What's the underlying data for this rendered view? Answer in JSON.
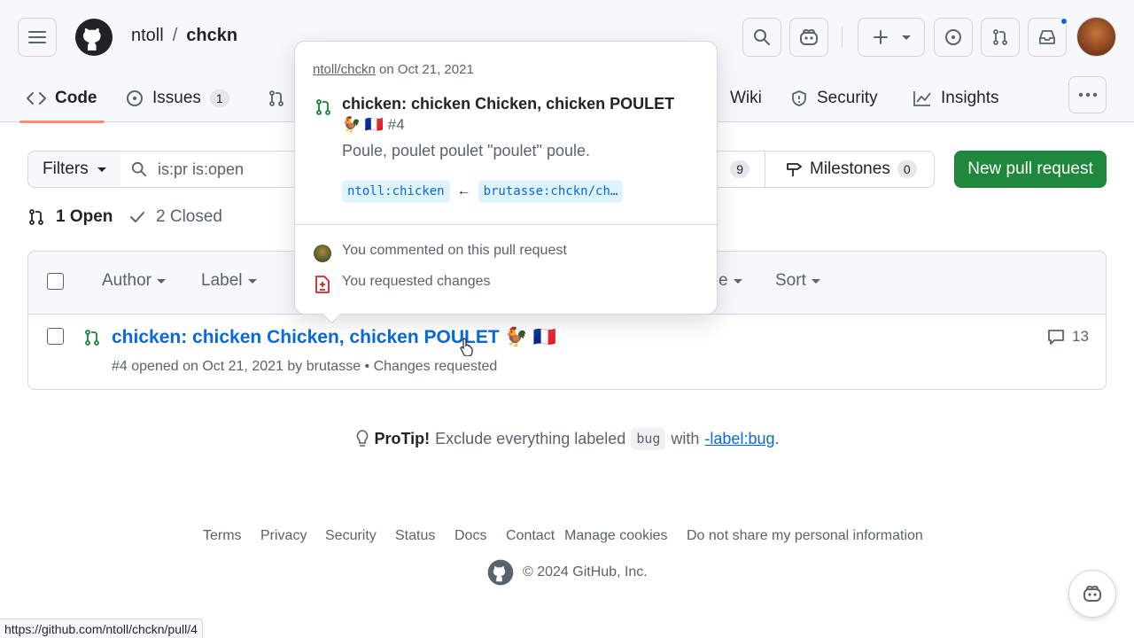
{
  "header": {
    "owner": "ntoll",
    "separator": "/",
    "repo": "chckn"
  },
  "tabs": [
    {
      "label": "Code",
      "icon": "code-icon"
    },
    {
      "label": "Issues",
      "count": "1",
      "icon": "issue-opened-icon"
    },
    {
      "label": "Wiki",
      "icon": "book-icon"
    },
    {
      "label": "Security",
      "icon": "shield-icon"
    },
    {
      "label": "Insights",
      "icon": "graph-icon"
    }
  ],
  "toolbar": {
    "filters_label": "Filters",
    "search_placeholder": "is:pr is:open",
    "labels_count": "9",
    "milestones_label": "Milestones",
    "milestones_count": "0",
    "new_pr_label": "New pull request"
  },
  "state_tabs": {
    "open": "1 Open",
    "closed": "2 Closed"
  },
  "list_filters": {
    "author": "Author",
    "label": "Label",
    "partial": "e",
    "sort": "Sort"
  },
  "pull_request": {
    "title": "chicken: chicken Chicken, chicken POULET 🐓 🇫🇷",
    "meta": "#4 opened on Oct 21, 2021 by brutasse • Changes requested",
    "comments": "13"
  },
  "popover": {
    "repo_link": "ntoll/chckn",
    "date": "on Oct 21, 2021",
    "title": "chicken: chicken Chicken, chicken POULET",
    "title_suffix": "🐓 🇫🇷 #4",
    "body": "Poule, poulet poulet \"poulet\" poule.",
    "base_branch": "ntoll:chicken",
    "arrow": "←",
    "head_branch": "brutasse:chckn/ch…",
    "activity_comment": "You commented on this pull request",
    "activity_review": "You requested changes"
  },
  "protip": {
    "lead": "ProTip!",
    "text_before": "Exclude everything labeled",
    "code": "bug",
    "text_mid": "with",
    "link": "-label:bug",
    "text_end": "."
  },
  "footer": {
    "links": [
      "Terms",
      "Privacy",
      "Security",
      "Status",
      "Docs",
      "Contact",
      "Manage cookies",
      "Do not share my personal information"
    ],
    "copyright": "© 2024 GitHub, Inc."
  },
  "status_url": "https://github.com/ntoll/chckn/pull/4",
  "colors": {
    "accent": "#0969da",
    "green": "#1f883d",
    "tab_underline": "#fd8c73",
    "review_red": "#cf222e"
  }
}
